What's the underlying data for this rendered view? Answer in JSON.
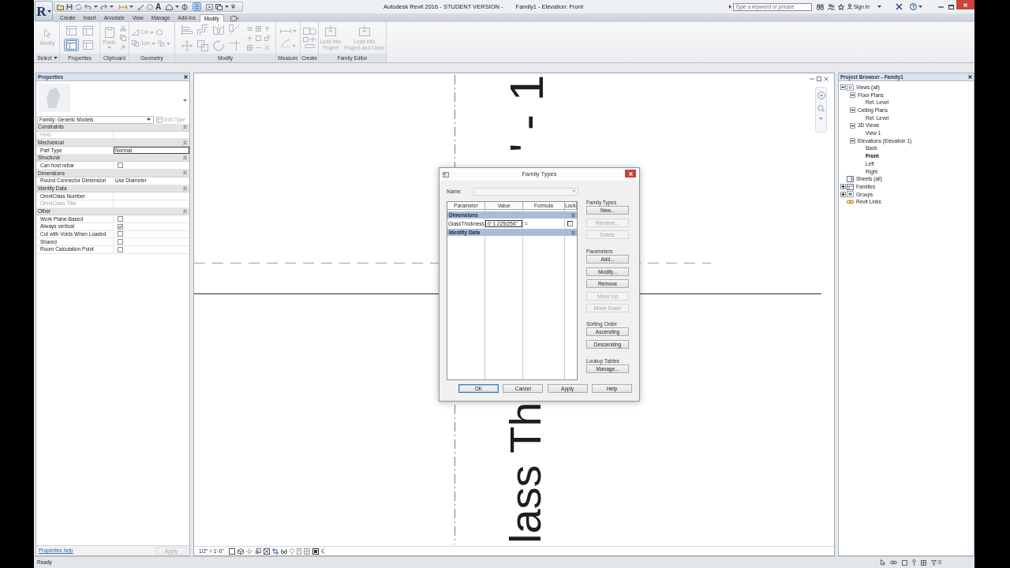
{
  "window": {
    "title": "Autodesk Revit 2016 - STUDENT VERSION -",
    "document": "Family1 - Elevation: Front"
  },
  "app_menu": {
    "label": "R"
  },
  "quick_access": {
    "text_tool": "A",
    "toggle": {
      "on": true
    }
  },
  "search": {
    "placeholder": "Type a keyword or phrase"
  },
  "info_center": {
    "sign_in": "Sign In"
  },
  "ribbon": {
    "tabs": [
      {
        "label": "Create",
        "selected": false
      },
      {
        "label": "Insert",
        "selected": false
      },
      {
        "label": "Annotate",
        "selected": false
      },
      {
        "label": "View",
        "selected": false
      },
      {
        "label": "Manage",
        "selected": false
      },
      {
        "label": "Add-Ins",
        "selected": false
      },
      {
        "label": "Modify",
        "selected": true
      }
    ],
    "panels": [
      {
        "label": "Select",
        "menu": true,
        "tools": [
          {
            "label": "Modify",
            "disabled": true
          }
        ]
      },
      {
        "label": "Properties",
        "menu": false,
        "toggles": [
          {
            "on": false
          },
          {
            "on": false
          },
          {
            "on": true
          },
          {
            "on": false
          }
        ]
      },
      {
        "label": "Clipboard",
        "menu": false,
        "tools": [
          {
            "label": "Paste",
            "disabled": true
          }
        ]
      },
      {
        "label": "Geometry",
        "menu": false,
        "tools": [
          {
            "label": "Cut",
            "disabled": true
          },
          {
            "label": "Join",
            "disabled": true
          }
        ]
      },
      {
        "label": "Modify",
        "menu": false
      },
      {
        "label": "Measure",
        "menu": false
      },
      {
        "label": "Create",
        "menu": false
      },
      {
        "label": "Family Editor",
        "menu": false,
        "tools": [
          {
            "label": "Load into\nProject",
            "disabled": true
          },
          {
            "label": "Load into\nProject and Close",
            "disabled": true
          }
        ]
      }
    ]
  },
  "properties": {
    "title": "Properties",
    "type": "Family: Generic Models",
    "edit_type": {
      "label": "Edit Type",
      "disabled": true
    },
    "groups": [
      {
        "name": "Constraints",
        "expanded": true,
        "rows": [
          {
            "name": "Host",
            "kind": "text",
            "disabled": true
          }
        ]
      },
      {
        "name": "Mechanical",
        "expanded": true,
        "rows": [
          {
            "name": "Part Type",
            "kind": "field",
            "value": "Normal",
            "disabled": false
          }
        ]
      },
      {
        "name": "Structural",
        "expanded": true,
        "rows": [
          {
            "name": "Can host rebar",
            "kind": "checkbox",
            "checked": false,
            "disabled": false
          }
        ]
      },
      {
        "name": "Dimensions",
        "expanded": true,
        "rows": [
          {
            "name": "Round Connector Dimension",
            "kind": "text",
            "value": "Use Diameter",
            "disabled": false
          }
        ]
      },
      {
        "name": "Identity Data",
        "expanded": true,
        "rows": [
          {
            "name": "OmniClass Number",
            "kind": "text",
            "disabled": false
          },
          {
            "name": "OmniClass Title",
            "kind": "text",
            "disabled": true
          }
        ]
      },
      {
        "name": "Other",
        "expanded": true,
        "rows": [
          {
            "name": "Work Plane-Based",
            "kind": "checkbox",
            "checked": false,
            "disabled": false
          },
          {
            "name": "Always vertical",
            "kind": "checkbox",
            "checked": true,
            "disabled": false
          },
          {
            "name": "Cut with Voids When Loaded",
            "kind": "checkbox",
            "checked": false,
            "disabled": false
          },
          {
            "name": "Shared",
            "kind": "checkbox",
            "checked": false,
            "disabled": false
          },
          {
            "name": "Room Calculation Point",
            "kind": "checkbox",
            "checked": false,
            "disabled": false
          }
        ]
      }
    ],
    "help_link": "Properties help",
    "apply": {
      "label": "Apply",
      "disabled": true
    }
  },
  "canvas": {
    "texts": [
      "' - 1",
      "lass Th"
    ],
    "scale": "1/2\" = 1'-0\""
  },
  "dialog": {
    "title": "Family Types",
    "name_label": "Name:",
    "columns": [
      "Parameter",
      "Value",
      "Formula",
      "Lock"
    ],
    "groups": [
      {
        "name": "Dimensions",
        "expanded": true,
        "rows": [
          {
            "parameter": "GlassThickness",
            "value": "0' 1 225/256\"",
            "formula": "=",
            "locked": false
          }
        ]
      },
      {
        "name": "Identity Data",
        "expanded": false
      }
    ],
    "sections": [
      {
        "title": "Family Types",
        "buttons": [
          {
            "label": "New...",
            "disabled": false
          },
          {
            "label": "Rename...",
            "disabled": true
          },
          {
            "label": "Delete",
            "disabled": true
          }
        ]
      },
      {
        "title": "Parameters",
        "buttons": [
          {
            "label": "Add...",
            "disabled": false
          },
          {
            "label": "Modify...",
            "disabled": false
          },
          {
            "label": "Remove",
            "disabled": false
          },
          {
            "label": "Move Up",
            "disabled": true
          },
          {
            "label": "Move Down",
            "disabled": true
          }
        ]
      },
      {
        "title": "Sorting Order",
        "buttons": [
          {
            "label": "Ascending",
            "disabled": false
          },
          {
            "label": "Descending",
            "disabled": false
          }
        ]
      },
      {
        "title": "Lookup Tables",
        "buttons": [
          {
            "label": "Manage...",
            "disabled": false
          }
        ]
      }
    ],
    "buttons": [
      {
        "label": "OK",
        "focused": true
      },
      {
        "label": "Cancel",
        "focused": false
      },
      {
        "label": "Apply",
        "focused": false
      },
      {
        "label": "Help",
        "focused": false
      }
    ]
  },
  "project_browser": {
    "title": "Project Browser - Family1",
    "tree": [
      {
        "label": "Views (all)",
        "kind": "views",
        "expanded": true,
        "selected": false,
        "children": [
          {
            "label": "Floor Plans",
            "expanded": true,
            "selected": false,
            "children": [
              {
                "label": "Ref. Level",
                "selected": false
              }
            ]
          },
          {
            "label": "Ceiling Plans",
            "expanded": true,
            "selected": false,
            "children": [
              {
                "label": "Ref. Level",
                "selected": false
              }
            ]
          },
          {
            "label": "3D Views",
            "expanded": true,
            "selected": false,
            "children": [
              {
                "label": "View 1",
                "selected": false
              }
            ]
          },
          {
            "label": "Elevations (Elevation 1)",
            "expanded": true,
            "selected": false,
            "children": [
              {
                "label": "Back",
                "selected": false
              },
              {
                "label": "Front",
                "selected": true
              },
              {
                "label": "Left",
                "selected": false
              },
              {
                "label": "Right",
                "selected": false
              }
            ]
          }
        ]
      },
      {
        "label": "Sheets (all)",
        "kind": "sheets",
        "selected": false
      },
      {
        "label": "Families",
        "kind": "families",
        "expanded": false,
        "selected": false
      },
      {
        "label": "Groups",
        "kind": "groups",
        "expanded": false,
        "selected": false
      },
      {
        "label": "Revit Links",
        "kind": "links",
        "selected": false
      }
    ]
  },
  "status_bar": {
    "text": "Ready",
    "filter_count": ":0"
  }
}
